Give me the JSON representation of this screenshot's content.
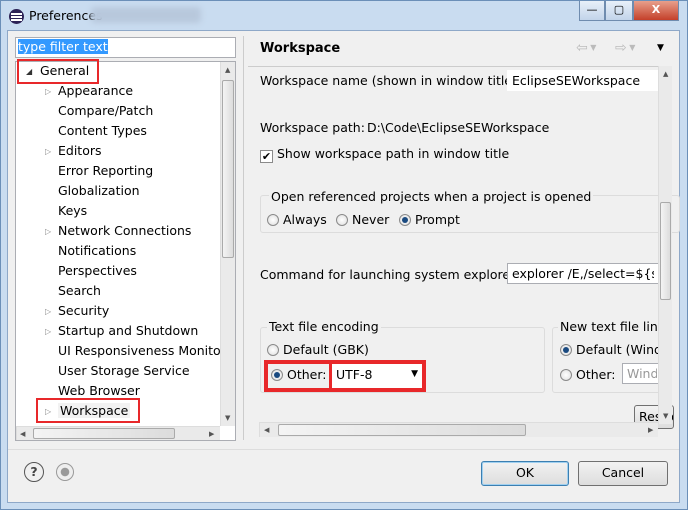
{
  "window": {
    "title": "Preferences",
    "minimize": "—",
    "maximize": "▢",
    "close": "X"
  },
  "filter": {
    "value": "type filter text"
  },
  "tree": {
    "items": [
      {
        "label": "General",
        "expander": "expanded",
        "level": 0
      },
      {
        "label": "Appearance",
        "expander": "collapsed",
        "level": 1
      },
      {
        "label": "Compare/Patch",
        "expander": "none",
        "level": 1
      },
      {
        "label": "Content Types",
        "expander": "none",
        "level": 1
      },
      {
        "label": "Editors",
        "expander": "collapsed",
        "level": 1
      },
      {
        "label": "Error Reporting",
        "expander": "none",
        "level": 1
      },
      {
        "label": "Globalization",
        "expander": "none",
        "level": 1
      },
      {
        "label": "Keys",
        "expander": "none",
        "level": 1
      },
      {
        "label": "Network Connections",
        "expander": "collapsed",
        "level": 1
      },
      {
        "label": "Notifications",
        "expander": "none",
        "level": 1
      },
      {
        "label": "Perspectives",
        "expander": "none",
        "level": 1
      },
      {
        "label": "Search",
        "expander": "none",
        "level": 1
      },
      {
        "label": "Security",
        "expander": "collapsed",
        "level": 1
      },
      {
        "label": "Startup and Shutdown",
        "expander": "collapsed",
        "level": 1
      },
      {
        "label": "UI Responsiveness Monitor",
        "expander": "none",
        "level": 1
      },
      {
        "label": "User Storage Service",
        "expander": "none",
        "level": 1
      },
      {
        "label": "Web Browser",
        "expander": "none",
        "level": 1
      },
      {
        "label": "Workspace",
        "expander": "collapsed",
        "level": 1,
        "selected": true
      }
    ]
  },
  "page": {
    "title": "Workspace",
    "nav": {
      "back": "⇦",
      "forward": "⇨",
      "menu": "▼"
    },
    "ws_name_label": "Workspace name (shown in window title):",
    "ws_name_value": "EclipseSEWorkspace",
    "ws_path_label": "Workspace path:",
    "ws_path_value": "D:\\Code\\EclipseSEWorkspace",
    "show_path_label": "Show workspace path in window title",
    "show_path_checked": true,
    "open_ref_label": "Open referenced projects when a project is opened",
    "open_ref_options": [
      "Always",
      "Never",
      "Prompt"
    ],
    "open_ref_selected": "Prompt",
    "explorer_label": "Command for launching system explorer:",
    "explorer_value": "explorer /E,/select=${selected_resource_loc}",
    "encoding_title": "Text file encoding",
    "encoding_default": "Default (GBK)",
    "encoding_other": "Other:",
    "encoding_value": "UTF-8",
    "encoding_selected": "Other",
    "line_delim_title": "New text file line delimiter",
    "line_default": "Default (Windows)",
    "line_other": "Other:",
    "line_other_value": "Windows",
    "line_selected": "Default",
    "restore_label": "Restore Defaults"
  },
  "footer": {
    "ok": "OK",
    "cancel": "Cancel",
    "help_icon": "?"
  },
  "highlight_color": "#e8282a"
}
